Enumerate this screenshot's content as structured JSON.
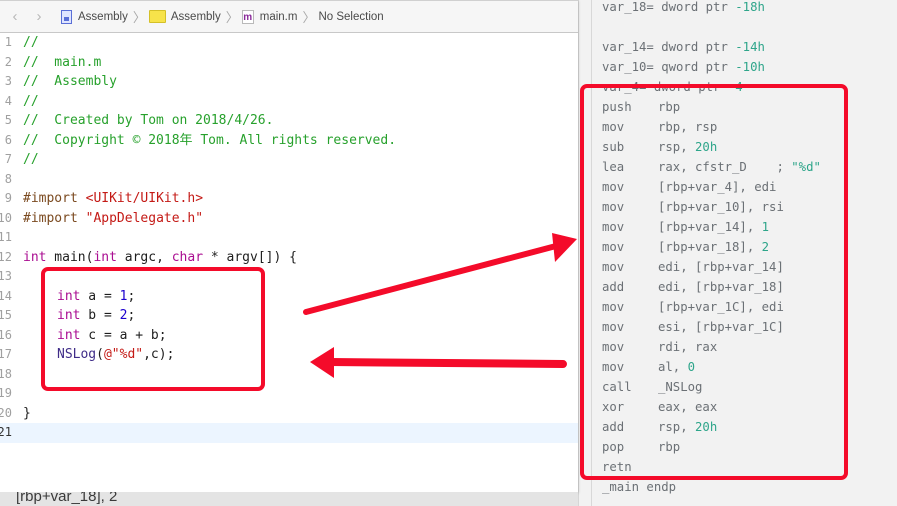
{
  "jumpbar": {
    "back_icon": "chevron-left-icon",
    "forward_icon": "chevron-right-icon",
    "breadcrumbs": [
      {
        "label": "Assembly",
        "icon": "xcode-project-icon"
      },
      {
        "label": "Assembly",
        "icon": "folder-icon"
      },
      {
        "label": "main.m",
        "icon": "objc-file-icon",
        "icon_glyph": "m"
      },
      {
        "label": "No Selection"
      }
    ],
    "separator": "〉"
  },
  "editor": {
    "line_numbers": [
      "1",
      "2",
      "3",
      "4",
      "5",
      "6",
      "7",
      "8",
      "9",
      "10",
      "11",
      "12",
      "13",
      "14",
      "15",
      "16",
      "17",
      "18",
      "19",
      "20",
      "21"
    ],
    "lines": [
      "//",
      "//  main.m",
      "//  Assembly",
      "//",
      "//  Created by Tom on 2018/4/26.",
      "//  Copyright © 2018年 Tom. All rights reserved.",
      "//",
      "",
      "#import <UIKit/UIKit.h>",
      "#import \"AppDelegate.h\"",
      "",
      "int main(int argc, char * argv[]) {",
      "",
      "    int a = 1;",
      "    int b = 2;",
      "    int c = a + b;",
      "    NSLog(@\"%d\",c);",
      "",
      "",
      "}",
      ""
    ],
    "current_line": 21,
    "tokens": {
      "import_kw": "#import",
      "uikit": "<UIKit/UIKit.h>",
      "appdelegate": "\"AppDelegate.h\"",
      "int": "int",
      "char": "char",
      "main_sig_1": " main(",
      "main_sig_2": " argc, ",
      "main_sig_3": " * argv[]) {",
      "var_a": " a = ",
      "val_1": "1",
      "var_b": " b = ",
      "val_2": "2",
      "var_c": " c = a + b;",
      "semi": ";",
      "nslog": "NSLog",
      "paren_open": "(",
      "fmt": "@\"%d\"",
      "nslog_tail": ",c);",
      "close_brace": "}"
    }
  },
  "bottom_strip_text": "[rbp+var_18], 2",
  "disassembly": {
    "header": [
      {
        "text": "var_18= dword ptr ",
        "num": "-18h"
      },
      {
        "text": "var_14= dword ptr ",
        "num": "-14h"
      },
      {
        "text": "var_10= qword ptr ",
        "num": "-10h"
      },
      {
        "text": "var_4= dword ptr ",
        "num": "-4"
      }
    ],
    "instructions": [
      {
        "op": "push",
        "args": "rbp"
      },
      {
        "op": "mov",
        "args": "rbp, rsp"
      },
      {
        "op": "sub",
        "args": "rsp, ",
        "num": "20h"
      },
      {
        "op": "lea",
        "args": "rax, cfstr_D    ; ",
        "str": "\"%d\""
      },
      {
        "op": "mov",
        "args": "[rbp+var_4], edi"
      },
      {
        "op": "mov",
        "args": "[rbp+var_10], rsi"
      },
      {
        "op": "mov",
        "args": "[rbp+var_14], ",
        "num": "1"
      },
      {
        "op": "mov",
        "args": "[rbp+var_18], ",
        "num": "2"
      },
      {
        "op": "mov",
        "args": "edi, [rbp+var_14]"
      },
      {
        "op": "add",
        "args": "edi, [rbp+var_18]"
      },
      {
        "op": "mov",
        "args": "[rbp+var_1C], edi"
      },
      {
        "op": "mov",
        "args": "esi, [rbp+var_1C]"
      },
      {
        "op": "mov",
        "args": "rdi, rax"
      },
      {
        "op": "mov",
        "args": "al, ",
        "num": "0"
      },
      {
        "op": "call",
        "args": "_NSLog"
      },
      {
        "op": "xor",
        "args": "eax, eax"
      },
      {
        "op": "add",
        "args": "rsp, ",
        "num": "20h"
      },
      {
        "op": "pop",
        "args": "rbp"
      },
      {
        "op": "retn",
        "args": ""
      }
    ],
    "footer": "_main endp"
  },
  "annotations": {
    "color": "#f40b2a",
    "boxes": [
      "source-highlight-box",
      "assembly-highlight-box"
    ],
    "arrows": [
      "arrow-source-to-assembly",
      "arrow-assembly-to-source"
    ]
  }
}
